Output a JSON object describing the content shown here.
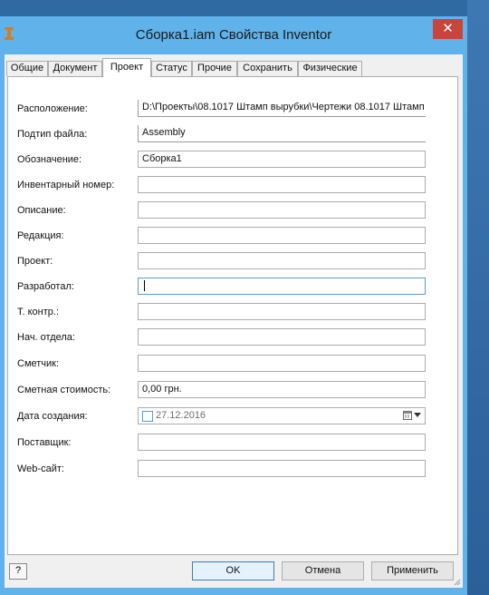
{
  "window": {
    "title": "Сборка1.iam Свойства Inventor",
    "close_symbol": "✕"
  },
  "tabs": [
    {
      "label": "Общие",
      "active": false
    },
    {
      "label": "Документ",
      "active": false
    },
    {
      "label": "Проект",
      "active": true
    },
    {
      "label": "Статус",
      "active": false
    },
    {
      "label": "Прочие",
      "active": false
    },
    {
      "label": "Сохранить",
      "active": false
    },
    {
      "label": "Физические",
      "active": false
    }
  ],
  "fields": {
    "location": {
      "label": "Расположение:",
      "value": "D:\\Проекты\\08.1017 Штамп вырубки\\Чертежи 08.1017 Штамп"
    },
    "subtype": {
      "label": "Подтип файла:",
      "value": "Assembly"
    },
    "part_number": {
      "label": "Обозначение:",
      "value": "Сборка1"
    },
    "stock_number": {
      "label": "Инвентарный номер:",
      "value": ""
    },
    "description": {
      "label": "Описание:",
      "value": ""
    },
    "revision": {
      "label": "Редакция:",
      "value": ""
    },
    "project": {
      "label": "Проект:",
      "value": ""
    },
    "designer": {
      "label": "Разработал:",
      "value": ""
    },
    "engineer": {
      "label": "Т. контр.:",
      "value": ""
    },
    "department_head": {
      "label": "Нач. отдела:",
      "value": ""
    },
    "estimator": {
      "label": "Сметчик:",
      "value": ""
    },
    "estimated_cost": {
      "label": "Сметная стоимость:",
      "value": "0,00 грн."
    },
    "creation_date": {
      "label": "Дата создания:",
      "value": "27.12.2016"
    },
    "vendor": {
      "label": "Поставщик:",
      "value": ""
    },
    "website": {
      "label": "Web-сайт:",
      "value": ""
    }
  },
  "buttons": {
    "help": "?",
    "ok": "OK",
    "cancel": "Отмена",
    "apply": "Применить"
  },
  "icons": {
    "app": "inventor-app-icon",
    "calendar": "calendar-icon",
    "help": "help-icon",
    "grip": "resize-grip-icon"
  },
  "colors": {
    "titlebar": "#5fb2ea",
    "close_button": "#c7463a",
    "focus_border": "#5b9bd5"
  }
}
